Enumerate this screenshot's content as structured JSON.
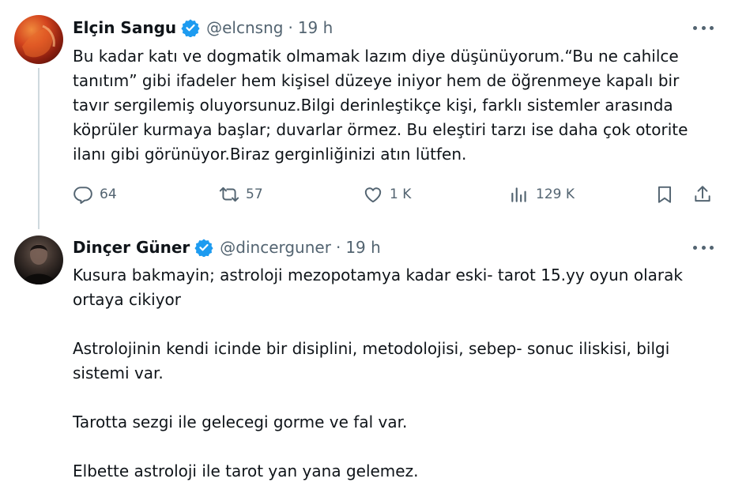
{
  "tweets": [
    {
      "author": "Elçin Sangu",
      "handle": "@elcnsng",
      "separator": "·",
      "time": "19 h",
      "text": "Bu kadar katı ve dogmatik olmamak lazım diye düşünüyorum.“Bu ne cahilce tanıtım” gibi ifadeler hem kişisel düzeye iniyor hem de öğrenmeye kapalı bir tavır sergilemiş oluyorsunuz.Bilgi derinleştikçe kişi, farklı sistemler arasında köprüler kurmaya başlar; duvarlar örmez. Bu eleştiri tarzı ise daha çok otorite ilanı gibi görünüyor.Biraz gerginliğinizi atın lütfen.",
      "actions": {
        "replies": "64",
        "reposts": "57",
        "likes": "1 K",
        "views": "129 K"
      }
    },
    {
      "author": "Dinçer Güner",
      "handle": "@dincerguner",
      "separator": "·",
      "time": "19 h",
      "paragraphs": [
        "Kusura bakmayin; astroloji mezopotamya kadar eski- tarot 15.yy oyun olarak ortaya cikiyor",
        "Astrolojinin kendi icinde bir disiplini, metodolojisi, sebep- sonuc iliskisi, bilgi sistemi var.",
        "Tarotta sezgi ile gelecegi gorme ve fal var.",
        "Elbette astroloji ile tarot yan yana gelemez."
      ]
    }
  ],
  "icons": {
    "verified": "verified-badge-icon",
    "more": "more-icon",
    "reply": "reply-icon",
    "repost": "repost-icon",
    "like": "like-icon",
    "views": "views-icon",
    "bookmark": "bookmark-icon",
    "share": "share-icon"
  },
  "colors": {
    "verified_blue": "#1d9bf0",
    "secondary_text": "#536471",
    "primary_text": "#0f1419",
    "thread_line": "#cfd9de"
  }
}
